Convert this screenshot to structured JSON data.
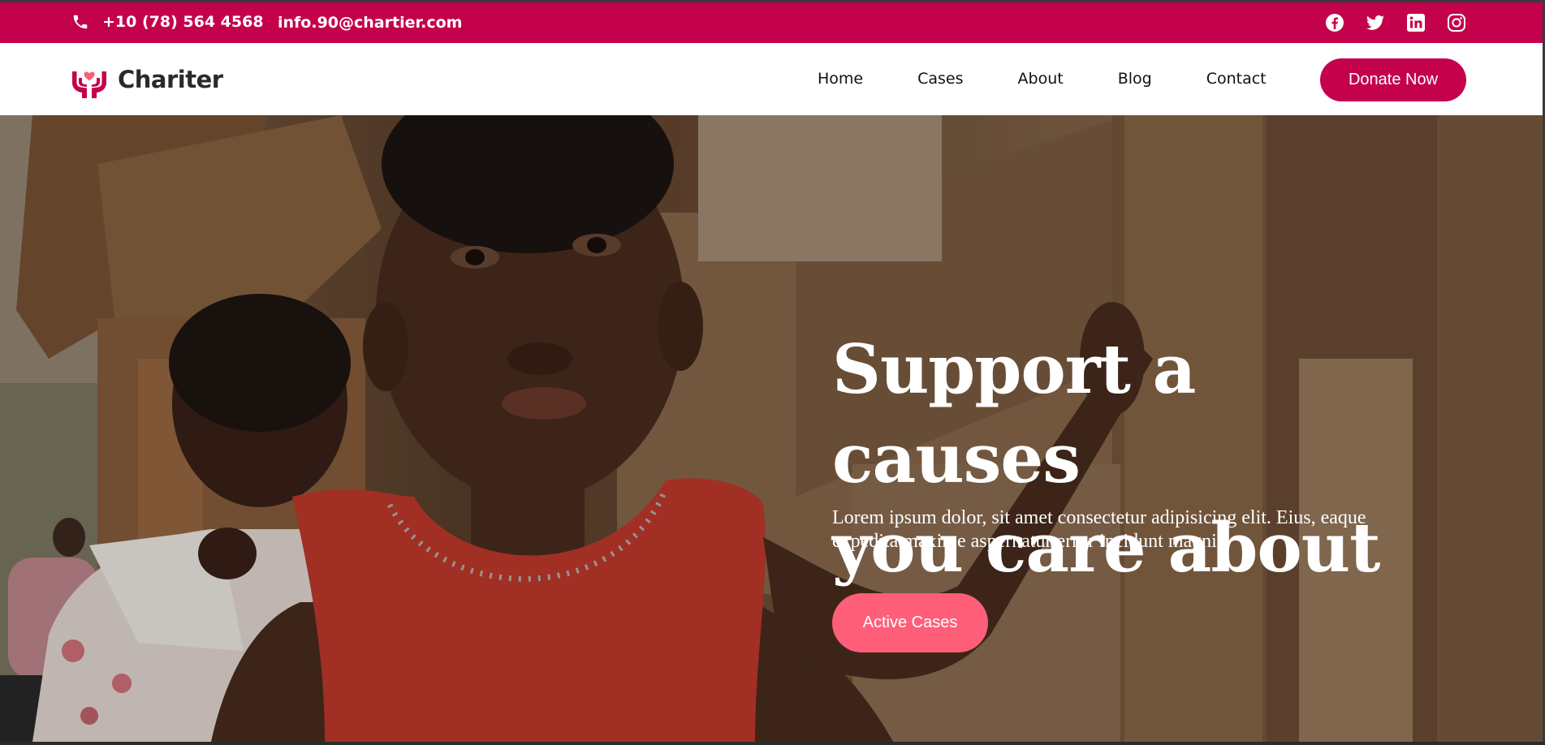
{
  "topbar": {
    "phone": "+10 (78) 564 4568",
    "email": "info.90@chartier.com",
    "socials": [
      "facebook-icon",
      "twitter-icon",
      "linkedin-icon",
      "instagram-icon"
    ]
  },
  "header": {
    "logo_text": "Chariter",
    "nav": [
      "Home",
      "Cases",
      "About",
      "Blog",
      "Contact"
    ],
    "donate_label": "Donate Now"
  },
  "hero": {
    "title_line1": "Support a causes",
    "title_line2": "you care about",
    "text": "Lorem ipsum dolor, sit amet consectetur adipisicing elit. Eius, eaque expedita maxime aspernatur error incidunt magni?",
    "button_label": "Active Cases"
  },
  "colors": {
    "brand": "#c4024c",
    "accent": "#ff5e78",
    "white": "#ffffff"
  }
}
